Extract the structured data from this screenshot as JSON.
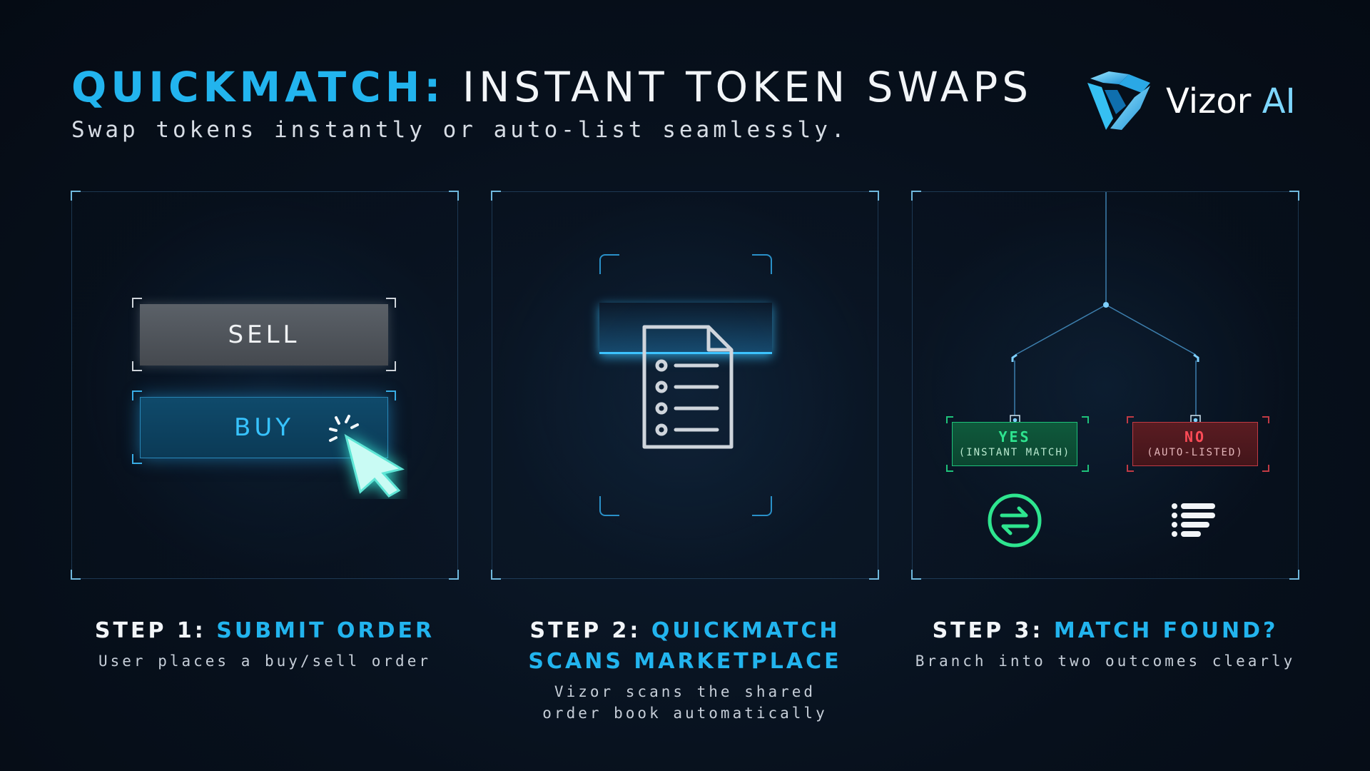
{
  "header": {
    "title_accent": "QUICKMATCH:",
    "title_rest": "INSTANT TOKEN SWAPS",
    "subtitle": "Swap tokens instantly or auto-list seamlessly."
  },
  "logo": {
    "name": "Vizor",
    "suffix": "AI",
    "icon": "vizor-logo-icon"
  },
  "panel1": {
    "sell_label": "SELL",
    "buy_label": "BUY",
    "icon": "cursor-click-icon"
  },
  "panel2": {
    "icon": "document-list-icon"
  },
  "panel3": {
    "yes_label": "YES",
    "yes_sub": "(INSTANT MATCH)",
    "no_label": "NO",
    "no_sub": "(AUTO-LISTED)",
    "yes_icon": "swap-arrows-icon",
    "no_icon": "list-icon"
  },
  "steps": [
    {
      "prefix": "STEP 1:",
      "title": "SUBMIT ORDER",
      "title2": "",
      "desc": "User places a buy/sell order",
      "desc2": ""
    },
    {
      "prefix": "STEP 2:",
      "title": "QUICKMATCH",
      "title2": "SCANS MARKETPLACE",
      "desc": "Vizor scans the shared",
      "desc2": "order book automatically"
    },
    {
      "prefix": "STEP 3:",
      "title": "MATCH FOUND?",
      "title2": "",
      "desc": "Branch into two outcomes clearly",
      "desc2": ""
    }
  ],
  "colors": {
    "accent": "#22b4ee",
    "yes": "#2ee58f",
    "no": "#ff4b57",
    "background": "#07101c"
  }
}
